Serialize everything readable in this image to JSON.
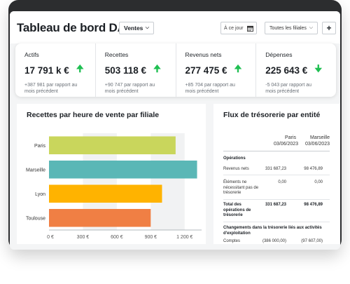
{
  "header": {
    "title": "Tableau de bord DAF",
    "view_select": "Ventes",
    "date_input": "À ce jour",
    "subsidiaries_select": "Toutes les filiales",
    "add_label": "+"
  },
  "kpis": [
    {
      "label": "Actifs",
      "value": "17 791 k €",
      "note": "+387 981 par rapport au mois précédent",
      "trend": "up"
    },
    {
      "label": "Recettes",
      "value": "503 118 €",
      "note": "+90 747 par rapport au mois précédent",
      "trend": "up"
    },
    {
      "label": "Revenus nets",
      "value": "277 475 €",
      "note": "+85 704 par rapport au mois précédent",
      "trend": "up"
    },
    {
      "label": "Dépenses",
      "value": "225 643 €",
      "note": "-5 043 par rapport au mois précédent",
      "trend": "down"
    }
  ],
  "chart_title": "Recettes par heure de vente par filiale",
  "chart_data": {
    "type": "bar",
    "orientation": "horizontal",
    "categories": [
      "Paris",
      "Marseille",
      "Lyon",
      "Toulouse"
    ],
    "values": [
      1120,
      1310,
      1000,
      900
    ],
    "colors": [
      "#c9d65c",
      "#5ab7b6",
      "#ffb300",
      "#f07f44"
    ],
    "xlim": [
      0,
      1350
    ],
    "xticks": [
      "0 €",
      "300 €",
      "600 €",
      "900 €",
      "1 200 €"
    ],
    "xtick_values": [
      0,
      300,
      600,
      900,
      1200
    ],
    "grid": "alternating-bands"
  },
  "cashflow": {
    "title": "Flux de trésorerie par entité",
    "columns": [
      {
        "name": "Paris",
        "date": "03/06/2023"
      },
      {
        "name": "Marseille",
        "date": "03/06/2023"
      }
    ],
    "section_operations": "Opérations",
    "rows": [
      {
        "label": "Revenus nets",
        "v1": "331 687,23",
        "v2": "98 476,89",
        "bold": false
      },
      {
        "label": "Éléments ne nécessitant pas de trésorerie",
        "v1": "0,00",
        "v2": "0,00",
        "bold": false
      },
      {
        "label": "Total des opérations de trésorerie",
        "v1": "331 687,23",
        "v2": "98 476,89",
        "bold": true
      }
    ],
    "section_changes": "Changements dans la trésorerie liés aux activités d'exploitation",
    "last_row": {
      "label": "Comptes",
      "v1": "(386 000,00)",
      "v2": "(97 607,00)"
    }
  }
}
